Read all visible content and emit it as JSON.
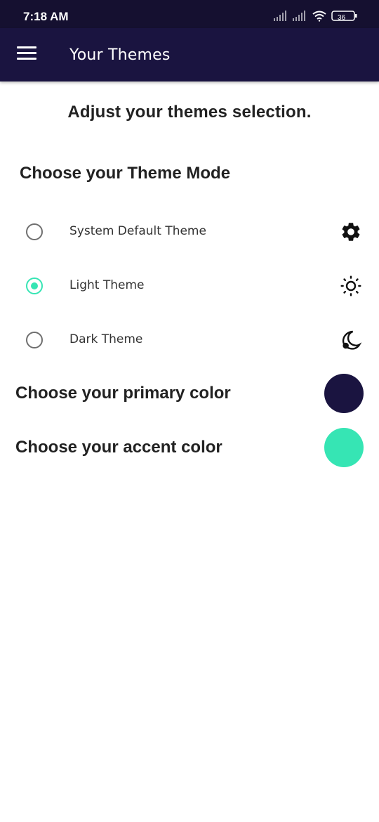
{
  "status_bar": {
    "time": "7:18 AM",
    "battery": "36"
  },
  "app_bar": {
    "title": "Your Themes"
  },
  "page": {
    "heading": "Adjust your themes selection."
  },
  "theme_mode": {
    "title": "Choose your Theme Mode",
    "options": [
      {
        "label": "System Default Theme",
        "icon": "gear-icon",
        "selected": false
      },
      {
        "label": "Light Theme",
        "icon": "sun-icon",
        "selected": true
      },
      {
        "label": "Dark Theme",
        "icon": "moon-icon",
        "selected": false
      }
    ]
  },
  "colors": {
    "primary_label": "Choose your primary color",
    "primary_value": "#1a1440",
    "accent_label": "Choose your accent color",
    "accent_value": "#36e5b4"
  }
}
